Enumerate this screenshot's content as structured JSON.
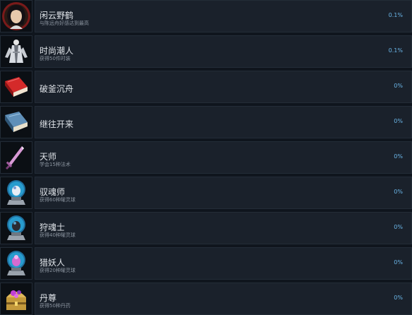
{
  "achievements": [
    {
      "title": "闲云野鹤",
      "description": "与陈远舟好感达到最高",
      "percent": "0.1%",
      "icon": "portrait-icon"
    },
    {
      "title": "时尚潮人",
      "description": "获得50件时装",
      "percent": "0.1%",
      "icon": "costume-figure-icon"
    },
    {
      "title": "破釜沉舟",
      "description": "",
      "percent": "0%",
      "icon": "red-book-icon"
    },
    {
      "title": "继往开来",
      "description": "",
      "percent": "0%",
      "icon": "blue-book-icon"
    },
    {
      "title": "天师",
      "description": "学会15种法术",
      "percent": "0%",
      "icon": "sword-icon"
    },
    {
      "title": "驭魂师",
      "description": "获得60种曜灵球",
      "percent": "0%",
      "icon": "spirit-orb-icon"
    },
    {
      "title": "狩魂士",
      "description": "获得40种曜灵球",
      "percent": "0%",
      "icon": "spirit-orb-icon"
    },
    {
      "title": "猎妖人",
      "description": "获得20种曜灵球",
      "percent": "0%",
      "icon": "spirit-orb-icon"
    },
    {
      "title": "丹尊",
      "description": "获得50种丹药",
      "percent": "0%",
      "icon": "treasure-chest-icon"
    }
  ]
}
